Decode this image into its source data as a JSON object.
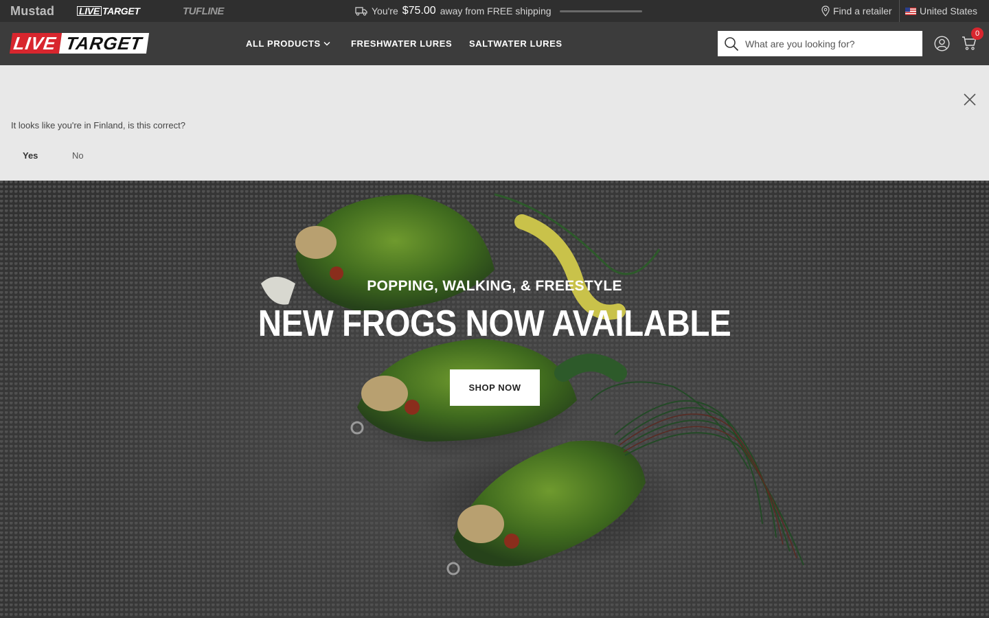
{
  "topbar": {
    "brands": [
      "Mustad",
      "LIVE",
      "TARGET",
      "TUFLINE"
    ],
    "shipping": {
      "prefix": "You're",
      "amount": "$75.00",
      "suffix": "away from FREE shipping",
      "progress": 0
    },
    "find_retailer": "Find a retailer",
    "country": "United States"
  },
  "header": {
    "logo": {
      "live": "LIVE",
      "target": "TARGET"
    },
    "nav": {
      "all_products": "ALL PRODUCTS",
      "freshwater": "FRESHWATER LURES",
      "saltwater": "SALTWATER LURES"
    },
    "search": {
      "placeholder": "What are you looking for?"
    },
    "cart": {
      "count": "0"
    }
  },
  "geo": {
    "message": "It looks like you're in Finland, is this correct?",
    "yes": "Yes",
    "no": "No"
  },
  "hero": {
    "subtitle": "POPPING, WALKING, & FREESTYLE",
    "title": "NEW FROGS NOW AVAILABLE",
    "button": "SHOP NOW"
  },
  "colors": {
    "accent_red": "#d8262e",
    "topbar": "#2f2f2f",
    "header": "#3c3c3c",
    "banner": "#e8e8e8"
  }
}
